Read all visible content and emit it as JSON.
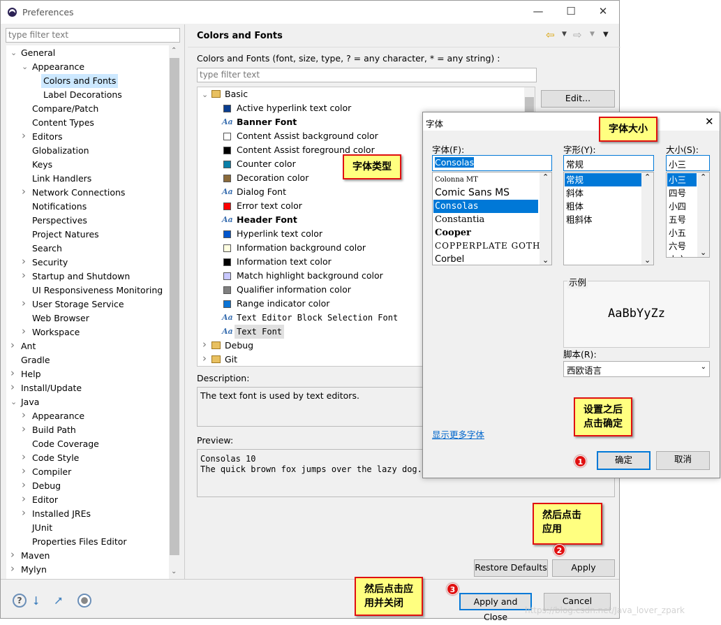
{
  "window": {
    "title": "Preferences",
    "filter_placeholder": "type filter text"
  },
  "left_tree": [
    {
      "label": "General",
      "level": 0,
      "arrow": "v"
    },
    {
      "label": "Appearance",
      "level": 1,
      "arrow": "v"
    },
    {
      "label": "Colors and Fonts",
      "level": 2,
      "arrow": "",
      "selected": true
    },
    {
      "label": "Label Decorations",
      "level": 2,
      "arrow": ""
    },
    {
      "label": "Compare/Patch",
      "level": 1,
      "arrow": ""
    },
    {
      "label": "Content Types",
      "level": 1,
      "arrow": ""
    },
    {
      "label": "Editors",
      "level": 1,
      "arrow": ">"
    },
    {
      "label": "Globalization",
      "level": 1,
      "arrow": ""
    },
    {
      "label": "Keys",
      "level": 1,
      "arrow": ""
    },
    {
      "label": "Link Handlers",
      "level": 1,
      "arrow": ""
    },
    {
      "label": "Network Connections",
      "level": 1,
      "arrow": ">"
    },
    {
      "label": "Notifications",
      "level": 1,
      "arrow": ""
    },
    {
      "label": "Perspectives",
      "level": 1,
      "arrow": ""
    },
    {
      "label": "Project Natures",
      "level": 1,
      "arrow": ""
    },
    {
      "label": "Search",
      "level": 1,
      "arrow": ""
    },
    {
      "label": "Security",
      "level": 1,
      "arrow": ">"
    },
    {
      "label": "Startup and Shutdown",
      "level": 1,
      "arrow": ">"
    },
    {
      "label": "UI Responsiveness Monitoring",
      "level": 1,
      "arrow": ""
    },
    {
      "label": "User Storage Service",
      "level": 1,
      "arrow": ">"
    },
    {
      "label": "Web Browser",
      "level": 1,
      "arrow": ""
    },
    {
      "label": "Workspace",
      "level": 1,
      "arrow": ">"
    },
    {
      "label": "Ant",
      "level": 0,
      "arrow": ">"
    },
    {
      "label": "Gradle",
      "level": 0,
      "arrow": ""
    },
    {
      "label": "Help",
      "level": 0,
      "arrow": ">"
    },
    {
      "label": "Install/Update",
      "level": 0,
      "arrow": ">"
    },
    {
      "label": "Java",
      "level": 0,
      "arrow": "v"
    },
    {
      "label": "Appearance",
      "level": 1,
      "arrow": ">"
    },
    {
      "label": "Build Path",
      "level": 1,
      "arrow": ">"
    },
    {
      "label": "Code Coverage",
      "level": 1,
      "arrow": ""
    },
    {
      "label": "Code Style",
      "level": 1,
      "arrow": ">"
    },
    {
      "label": "Compiler",
      "level": 1,
      "arrow": ">"
    },
    {
      "label": "Debug",
      "level": 1,
      "arrow": ">"
    },
    {
      "label": "Editor",
      "level": 1,
      "arrow": ">"
    },
    {
      "label": "Installed JREs",
      "level": 1,
      "arrow": ">"
    },
    {
      "label": "JUnit",
      "level": 1,
      "arrow": ""
    },
    {
      "label": "Properties Files Editor",
      "level": 1,
      "arrow": ""
    },
    {
      "label": "Maven",
      "level": 0,
      "arrow": ">"
    },
    {
      "label": "Mylyn",
      "level": 0,
      "arrow": ">"
    }
  ],
  "page": {
    "title": "Colors and Fonts",
    "intro": "Colors and Fonts (font, size, type, ? = any character, * = any string) :",
    "filter_placeholder": "type filter text",
    "edit_button": "Edit...",
    "description_label": "Description:",
    "description": "The text font is used by text editors.",
    "preview_label": "Preview:",
    "preview_lines": [
      "Consolas 10",
      "The quick brown fox jumps over the lazy dog."
    ],
    "restore_defaults": "Restore Defaults",
    "apply": "Apply",
    "apply_and_close": "Apply and Close",
    "cancel": "Cancel"
  },
  "font_tree": {
    "basic": "Basic",
    "items": [
      {
        "label": "Active hyperlink text color",
        "kind": "color",
        "color": "#0a3d8f"
      },
      {
        "label": "Banner Font",
        "kind": "font",
        "bold": true
      },
      {
        "label": "Content Assist background color",
        "kind": "color",
        "color": "#ffffff"
      },
      {
        "label": "Content Assist foreground color",
        "kind": "color",
        "color": "#000000"
      },
      {
        "label": "Counter color",
        "kind": "color",
        "color": "#0a7fa8"
      },
      {
        "label": "Decoration color",
        "kind": "color",
        "color": "#8a6a3a"
      },
      {
        "label": "Dialog Font",
        "kind": "font"
      },
      {
        "label": "Error text color",
        "kind": "color",
        "color": "#ff0000"
      },
      {
        "label": "Header Font",
        "kind": "font",
        "bold": true
      },
      {
        "label": "Hyperlink text color",
        "kind": "color",
        "color": "#0055cc"
      },
      {
        "label": "Information background color",
        "kind": "color",
        "color": "#ffffe1"
      },
      {
        "label": "Information text color",
        "kind": "color",
        "color": "#000000"
      },
      {
        "label": "Match highlight background color",
        "kind": "color",
        "color": "#c8c8ff"
      },
      {
        "label": "Qualifier information color",
        "kind": "color",
        "color": "#808080"
      },
      {
        "label": "Range indicator color",
        "kind": "color",
        "color": "#0a74d6"
      },
      {
        "label": "Text Editor Block Selection Font",
        "kind": "font",
        "mono": true
      },
      {
        "label": "Text Font",
        "kind": "font",
        "mono": true,
        "selected": true
      }
    ],
    "collapsed": [
      "Debug",
      "Git"
    ]
  },
  "font_dialog": {
    "title": "字体",
    "font_label": "字体(F):",
    "font_value": "Consolas",
    "fonts": [
      "Colonna MT",
      "Comic Sans MS",
      "Consolas",
      "Constantia",
      "Cooper",
      "COPPERPLATE GOTHIC",
      "Corbel"
    ],
    "style_label": "字形(Y):",
    "style_value": "常规",
    "styles": [
      "常规",
      "斜体",
      "粗体",
      "粗斜体"
    ],
    "size_label": "大小(S):",
    "size_value": "小三",
    "sizes": [
      "小三",
      "四号",
      "小四",
      "五号",
      "小五",
      "六号",
      "小六"
    ],
    "sample_label": "示例",
    "sample_text": "AaBbYyZz",
    "script_label": "脚本(R):",
    "script_value": "西欧语言",
    "more_fonts": "显示更多字体",
    "ok": "确定",
    "cancel": "取消"
  },
  "callouts": {
    "font_type": "字体类型",
    "font_size": "字体大小",
    "ok_note": [
      "设置之后",
      "点击确定"
    ],
    "apply_note": [
      "然后点击",
      "应用"
    ],
    "close_note": [
      "然后点击应",
      "用并关闭"
    ]
  },
  "badges": [
    "1",
    "2",
    "3"
  ],
  "watermark": "https://blog.csdn.net/Java_lover_zpark"
}
